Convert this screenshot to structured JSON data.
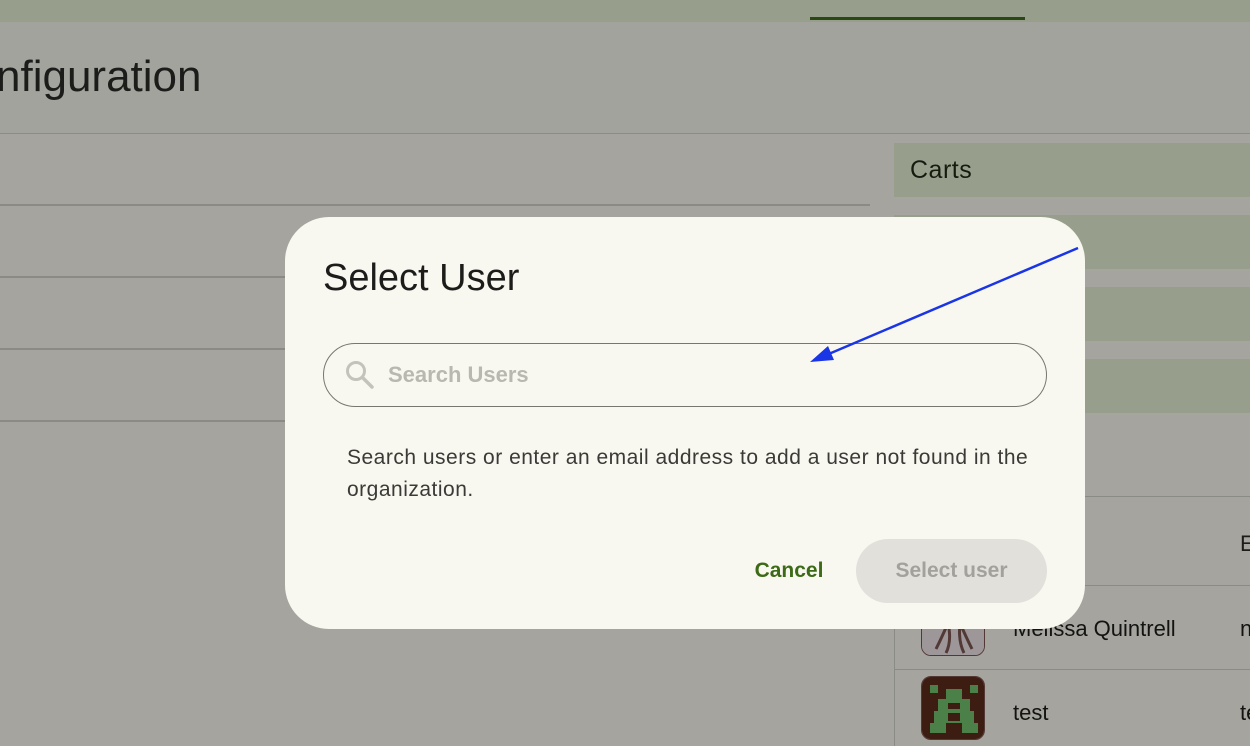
{
  "page": {
    "title": "nfiguration"
  },
  "right_panel": {
    "items": [
      "Carts",
      "",
      "",
      ""
    ],
    "table": {
      "header_truncated": "E",
      "rows": [
        {
          "name": "Melissa Quintrell",
          "truncated": "n"
        },
        {
          "name": "test",
          "truncated": "te"
        }
      ]
    }
  },
  "dialog": {
    "title": "Select User",
    "search_placeholder": "Search Users",
    "search_value": "",
    "helper_text": "Search users or enter an email address to add a user not found in the organization.",
    "cancel_label": "Cancel",
    "select_label": "Select user"
  },
  "colors": {
    "accent": "#3d6a17",
    "annotation_arrow": "#1a35e6",
    "disabled_button_bg": "#e1e0da"
  },
  "icons": {
    "search": "search-icon",
    "annotation": "arrow-icon"
  }
}
